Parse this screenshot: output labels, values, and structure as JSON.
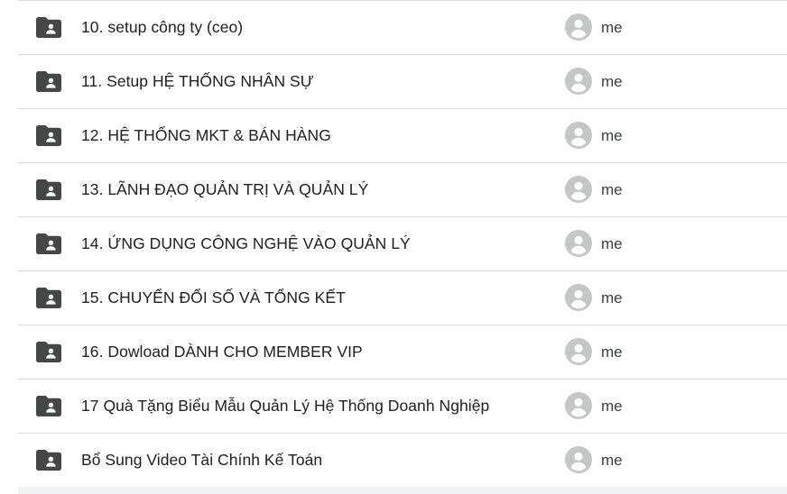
{
  "files": [
    {
      "name": "10. setup công ty (ceo)",
      "owner": "me",
      "icon": "shared-folder-icon"
    },
    {
      "name": "11. Setup HỆ THỐNG NHÂN SỰ",
      "owner": "me",
      "icon": "shared-folder-icon"
    },
    {
      "name": "12. HỆ THỐNG MKT & BÁN HÀNG",
      "owner": "me",
      "icon": "shared-folder-icon"
    },
    {
      "name": "13. LÃNH ĐẠO QUẢN TRỊ VÀ QUẢN LÝ",
      "owner": "me",
      "icon": "shared-folder-icon"
    },
    {
      "name": "14. ỨNG DỤNG CÔNG NGHỆ VÀO QUẢN LÝ",
      "owner": "me",
      "icon": "shared-folder-icon"
    },
    {
      "name": "15. CHUYỂN ĐỔI SỐ VÀ TỔNG KẾT",
      "owner": "me",
      "icon": "shared-folder-icon"
    },
    {
      "name": "16. Dowload DÀNH CHO MEMBER VIP",
      "owner": "me",
      "icon": "shared-folder-icon"
    },
    {
      "name": "17 Quà Tặng Biểu Mẫu Quản Lý Hệ Thống Doanh Nghiệp",
      "owner": "me",
      "icon": "shared-folder-icon"
    },
    {
      "name": "Bổ Sung Video Tài Chính Kế Toán",
      "owner": "me",
      "icon": "shared-folder-icon"
    }
  ],
  "colors": {
    "folder_icon": "#444746",
    "avatar_bg": "#c4c7c5",
    "avatar_figure": "#ffffff",
    "divider": "#dadce0",
    "text_primary": "#202124",
    "text_secondary": "#3c4043"
  }
}
